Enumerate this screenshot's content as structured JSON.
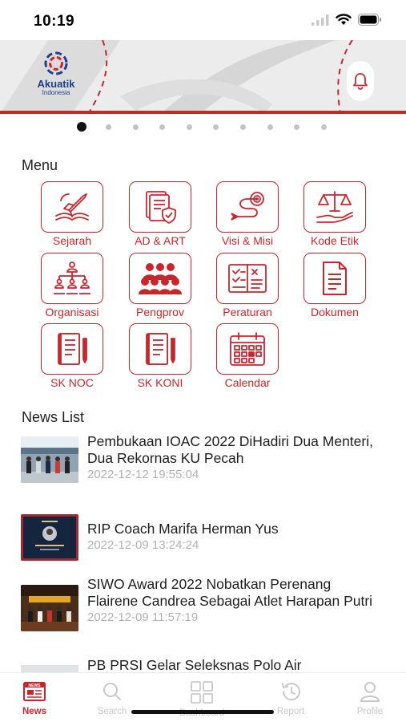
{
  "status": {
    "time": "10:19"
  },
  "brand": {
    "name": "Akuatik",
    "sub": "Indonesia"
  },
  "header": {
    "notification_icon": "bell-icon",
    "accent": "#c9262c"
  },
  "pager": {
    "count": 10,
    "active_index": 0
  },
  "menu": {
    "title": "Menu",
    "items": [
      {
        "label": "Sejarah",
        "icon": "rocket-book-icon"
      },
      {
        "label": "AD & ART",
        "icon": "document-shield-icon"
      },
      {
        "label": "Visi & Misi",
        "icon": "target-icon"
      },
      {
        "label": "Kode Etik",
        "icon": "scales-icon"
      },
      {
        "label": "Organisasi",
        "icon": "org-chart-icon"
      },
      {
        "label": "Pengprov",
        "icon": "group-icon"
      },
      {
        "label": "Peraturan",
        "icon": "checklist-icon"
      },
      {
        "label": "Dokumen",
        "icon": "document-icon"
      },
      {
        "label": "SK NOC",
        "icon": "notebook-pen-icon"
      },
      {
        "label": "SK KONI",
        "icon": "notebook-pen-icon"
      },
      {
        "label": "Calendar",
        "icon": "calendar-icon"
      }
    ]
  },
  "news": {
    "title": "News List",
    "items": [
      {
        "title": "Pembukaan IOAC 2022 DiHadiri Dua Menteri, Dua Rekornas KU Pecah",
        "date": "2022-12-12 19:55:04"
      },
      {
        "title": "RIP Coach Marifa Herman Yus",
        "date": "2022-12-09 13:24:24"
      },
      {
        "title": "SIWO Award 2022 Nobatkan Perenang Flairene Candrea Sebagai Atlet Harapan Putri",
        "date": "2022-12-09 11:57:19"
      },
      {
        "title": "PB PRSI Gelar Seleksnas Polo Air",
        "date": ""
      }
    ]
  },
  "nav": {
    "active": "News",
    "items": [
      {
        "label": "News",
        "icon": "newspaper-icon"
      },
      {
        "label": "Search",
        "icon": "search-icon"
      },
      {
        "label": "Dashboard",
        "icon": "grid-icon"
      },
      {
        "label": "Report",
        "icon": "history-icon"
      },
      {
        "label": "Profile",
        "icon": "user-icon"
      }
    ]
  }
}
